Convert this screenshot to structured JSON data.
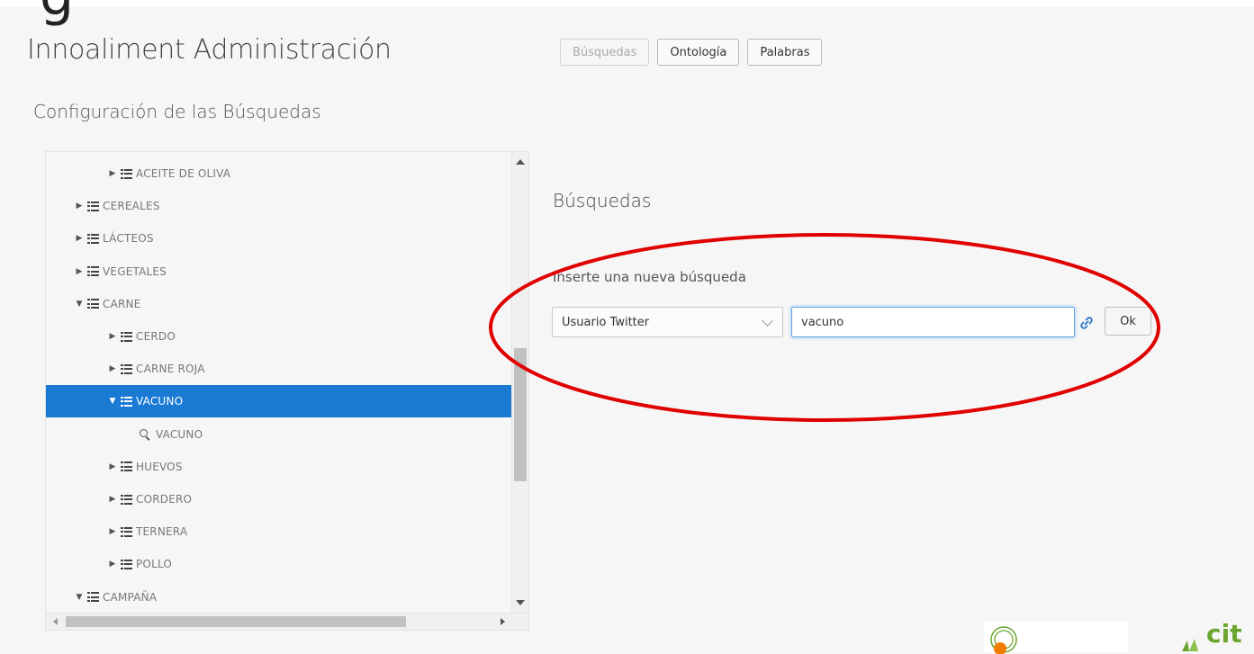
{
  "header": {
    "top_glyph": "g",
    "title": "Innoaliment Administración",
    "nav": [
      {
        "label": "Búsquedas",
        "disabled": true
      },
      {
        "label": "Ontología",
        "disabled": false
      },
      {
        "label": "Palabras",
        "disabled": false
      }
    ]
  },
  "section_title": "Configuración de las Búsquedas",
  "tree": {
    "items": [
      {
        "label": "ACEITE DE OLIVA",
        "level": 2,
        "expanded": false,
        "kind": "folder",
        "selected": false
      },
      {
        "label": "CEREALES",
        "level": 1,
        "expanded": false,
        "kind": "folder",
        "selected": false
      },
      {
        "label": "LÁCTEOS",
        "level": 1,
        "expanded": false,
        "kind": "folder",
        "selected": false
      },
      {
        "label": "VEGETALES",
        "level": 1,
        "expanded": false,
        "kind": "folder",
        "selected": false
      },
      {
        "label": "CARNE",
        "level": 1,
        "expanded": true,
        "kind": "folder",
        "selected": false
      },
      {
        "label": "CERDO",
        "level": 2,
        "expanded": false,
        "kind": "folder",
        "selected": false
      },
      {
        "label": "CARNE ROJA",
        "level": 2,
        "expanded": false,
        "kind": "folder",
        "selected": false
      },
      {
        "label": "VACUNO",
        "level": 2,
        "expanded": true,
        "kind": "folder",
        "selected": true
      },
      {
        "label": "VACUNO",
        "level": 3,
        "expanded": false,
        "kind": "search",
        "selected": false
      },
      {
        "label": "HUEVOS",
        "level": 2,
        "expanded": false,
        "kind": "folder",
        "selected": false
      },
      {
        "label": "CORDERO",
        "level": 2,
        "expanded": false,
        "kind": "folder",
        "selected": false
      },
      {
        "label": "TERNERA",
        "level": 2,
        "expanded": false,
        "kind": "folder",
        "selected": false
      },
      {
        "label": "POLLO",
        "level": 2,
        "expanded": false,
        "kind": "folder",
        "selected": false
      },
      {
        "label": "CAMPAÑA",
        "level": 1,
        "expanded": true,
        "kind": "folder",
        "selected": false
      }
    ]
  },
  "panel": {
    "title": "Búsquedas",
    "form_label": "Inserte una nueva búsqueda",
    "select_value": "Usuario Twitter",
    "input_value": "vacuno",
    "ok_label": "Ok"
  },
  "colors": {
    "selection": "#1a7ad4",
    "annotation": "#e00000",
    "logo_green": "#6aa52d",
    "logo_orange": "#f07d00"
  },
  "logos": {
    "cit_text": "cit"
  }
}
